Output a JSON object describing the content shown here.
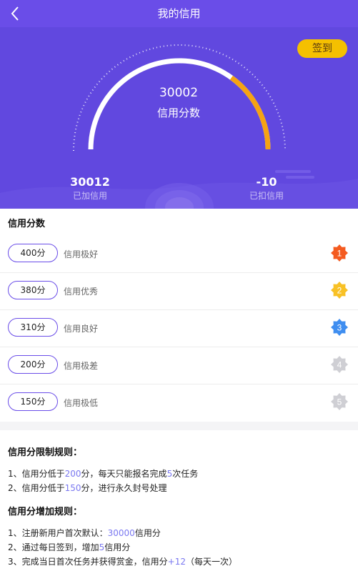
{
  "header": {
    "title": "我的信用",
    "back_icon": "chevron-left-icon"
  },
  "hero": {
    "checkin_label": "签到",
    "score_value": "30002",
    "score_label": "信用分数",
    "gauge_fill_fraction": 0.7,
    "added": {
      "value": "30012",
      "label": "已加信用"
    },
    "deducted": {
      "value": "-10",
      "label": "已扣信用"
    },
    "colors": {
      "background": "#6148df",
      "accent": "#f6a313",
      "track": "#ffffff"
    }
  },
  "levels": {
    "title": "信用分数",
    "items": [
      {
        "score": "400分",
        "desc": "信用极好",
        "rank": "1",
        "color": "#f45b20"
      },
      {
        "score": "380分",
        "desc": "信用优秀",
        "rank": "2",
        "color": "#f8c126"
      },
      {
        "score": "310分",
        "desc": "信用良好",
        "rank": "3",
        "color": "#3f8ef0"
      },
      {
        "score": "200分",
        "desc": "信用极差",
        "rank": "4",
        "color": "#cfcfd4"
      },
      {
        "score": "150分",
        "desc": "信用极低",
        "rank": "5",
        "color": "#cfcfd4"
      }
    ]
  },
  "rules": {
    "limit_title": "信用分限制规则：",
    "limit_1": {
      "a": "1、信用分低于",
      "b": "200",
      "c": "分，每天只能报名完成",
      "d": "5",
      "e": "次任务"
    },
    "limit_2": {
      "a": "2、信用分低于",
      "b": "150",
      "c": "分，进行永久封号处理"
    },
    "add_title": "信用分增加规则：",
    "add_1": {
      "a": "1、注册新用户首次默认：",
      "b": "30000",
      "c": "信用分"
    },
    "add_2": {
      "a": "2、通过每日签到，增加",
      "b": "5",
      "c": "信用分"
    },
    "add_3": {
      "a": "3、完成当日首次任务并获得赏金，信用分",
      "b": "+12",
      "c": "（每天一次）"
    }
  }
}
